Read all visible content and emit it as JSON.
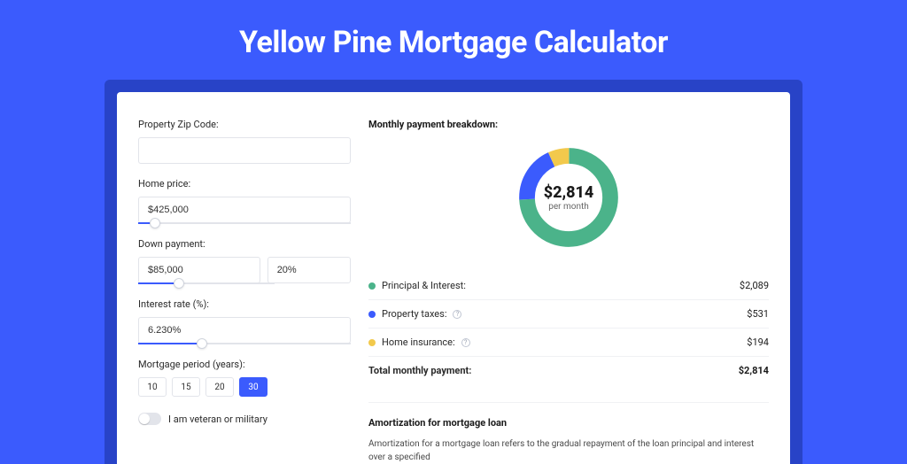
{
  "title": "Yellow Pine Mortgage Calculator",
  "form": {
    "zip_label": "Property Zip Code:",
    "zip_value": "",
    "home_price_label": "Home price:",
    "home_price_value": "$425,000",
    "home_price_slider_pct": 8,
    "down_payment_label": "Down payment:",
    "down_payment_value": "$85,000",
    "down_payment_pct_value": "20%",
    "down_payment_slider_pct": 20,
    "interest_label": "Interest rate (%):",
    "interest_value": "6.230%",
    "interest_slider_pct": 30,
    "period_label": "Mortgage period (years):",
    "period_options": [
      "10",
      "15",
      "20",
      "30"
    ],
    "period_selected": "30",
    "veteran_label": "I am veteran or military",
    "veteran_on": false
  },
  "breakdown": {
    "heading": "Monthly payment breakdown:",
    "donut_amount": "$2,814",
    "donut_sub": "per month",
    "items": [
      {
        "label": "Principal & Interest:",
        "value": "$2,089",
        "color": "#4bb38a",
        "info": false
      },
      {
        "label": "Property taxes:",
        "value": "$531",
        "color": "#3b5bfd",
        "info": true
      },
      {
        "label": "Home insurance:",
        "value": "$194",
        "color": "#f2c94c",
        "info": true
      }
    ],
    "total_label": "Total monthly payment:",
    "total_value": "$2,814"
  },
  "amortization": {
    "title": "Amortization for mortgage loan",
    "text": "Amortization for a mortgage loan refers to the gradual repayment of the loan principal and interest over a specified"
  },
  "chart_data": {
    "type": "pie",
    "title": "Monthly payment breakdown",
    "categories": [
      "Principal & Interest",
      "Property taxes",
      "Home insurance"
    ],
    "values": [
      2089,
      531,
      194
    ],
    "colors": [
      "#4bb38a",
      "#3b5bfd",
      "#f2c94c"
    ],
    "total": 2814,
    "center_label": "$2,814 per month"
  }
}
